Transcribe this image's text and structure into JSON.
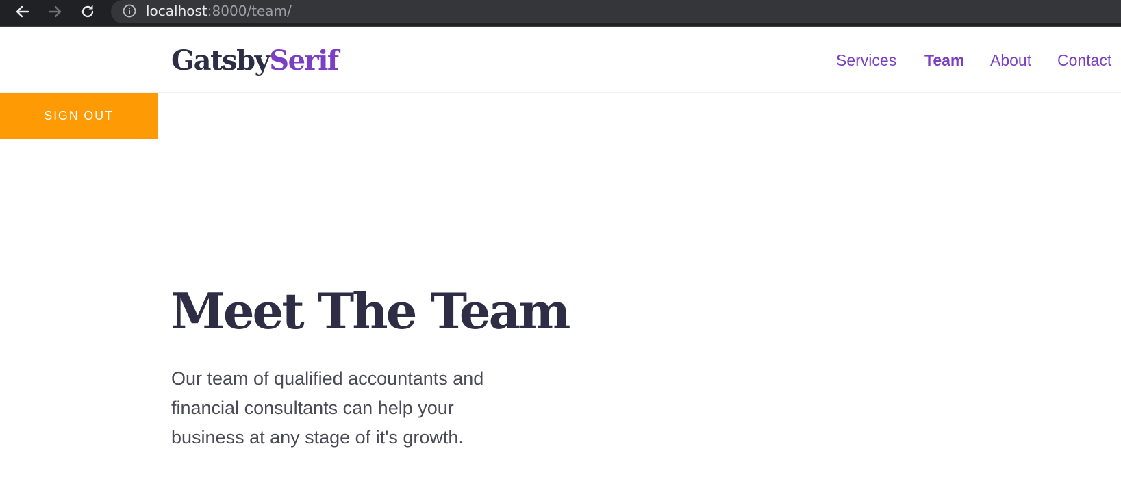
{
  "browser": {
    "url_host": "localhost",
    "url_path": ":8000/team/",
    "icons": {
      "back": "arrow-left-icon",
      "forward": "arrow-right-icon",
      "reload": "reload-icon",
      "site_info": "info-icon"
    }
  },
  "header": {
    "brand_part1": "Gatsby",
    "brand_part2": "Serif",
    "nav": [
      {
        "label": "Services",
        "active": false
      },
      {
        "label": "Team",
        "active": true
      },
      {
        "label": "About",
        "active": false
      },
      {
        "label": "Contact",
        "active": false
      }
    ]
  },
  "signout_label": "SIGN OUT",
  "hero": {
    "title": "Meet The Team",
    "text": "Our team of qualified accountants and financial consultants can help your business at any stage of it's growth."
  },
  "colors": {
    "accent": "#7b3fc4",
    "signout": "#fe9a03",
    "heading": "#2e2d45",
    "body_text": "#4b4b58",
    "browser_chrome": "#202124"
  }
}
